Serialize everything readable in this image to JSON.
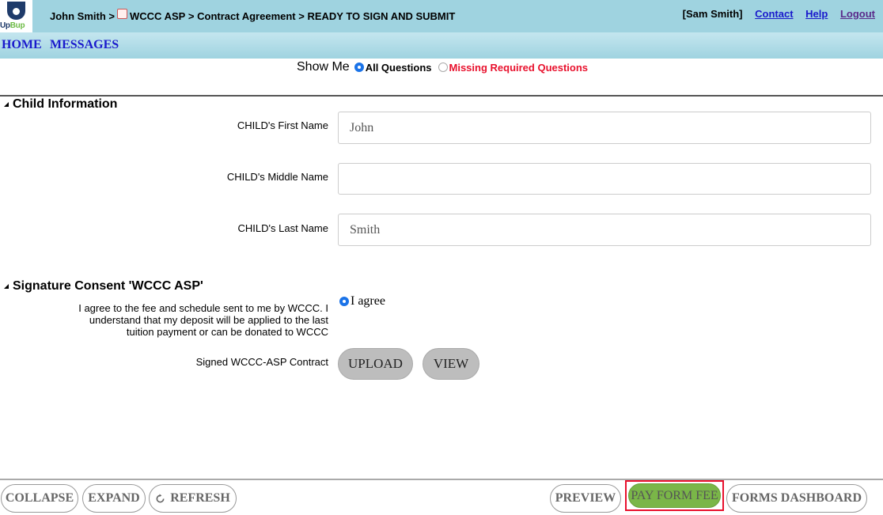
{
  "header": {
    "logo_text_a": "Up",
    "logo_text_b": "Bup",
    "breadcrumb_child": "John Smith",
    "breadcrumb_sep1": ">",
    "breadcrumb_org": "WCCC ASP",
    "breadcrumb_sep2": ">",
    "breadcrumb_form": "Contract Agreement",
    "breadcrumb_sep3": ">",
    "breadcrumb_status": "READY TO SIGN AND SUBMIT",
    "user": "[Sam Smith]",
    "links": {
      "contact": "Contact",
      "help": "Help",
      "logout": "Logout"
    }
  },
  "nav": {
    "home": "HOME",
    "messages": "MESSAGES"
  },
  "show_me": {
    "label": "Show Me",
    "options": [
      "All Questions",
      "Missing Required Questions"
    ],
    "selected": "All Questions"
  },
  "child_section": {
    "title": "Child Information",
    "fields": [
      {
        "label": "CHILD's First Name",
        "value": "John"
      },
      {
        "label": "CHILD's Middle Name",
        "value": ""
      },
      {
        "label": "CHILD's Last Name",
        "value": "Smith"
      }
    ]
  },
  "signature_section": {
    "title": "Signature Consent 'WCCC ASP'",
    "consent_text": "I agree to the fee and schedule sent to me by WCCC. I understand that my deposit will be applied to the last tuition payment or can be donated to WCCC",
    "agree_label": "I agree",
    "agree_checked": true,
    "contract_label": "Signed WCCC-ASP Contract",
    "upload_label": "UPLOAD",
    "view_label": "VIEW"
  },
  "footer": {
    "collapse": "COLLAPSE",
    "expand": "EXPAND",
    "refresh": "REFRESH",
    "preview": "PREVIEW",
    "pay_form_fee": "PAY FORM FEE",
    "forms_dashboard": "FORMS DASHBOARD"
  },
  "colors": {
    "header_bg": "#9fd3e0",
    "link": "#1a1acc",
    "missing": "#e8112d",
    "pay_button": "#7ab648",
    "highlight_border": "#e8112d"
  }
}
